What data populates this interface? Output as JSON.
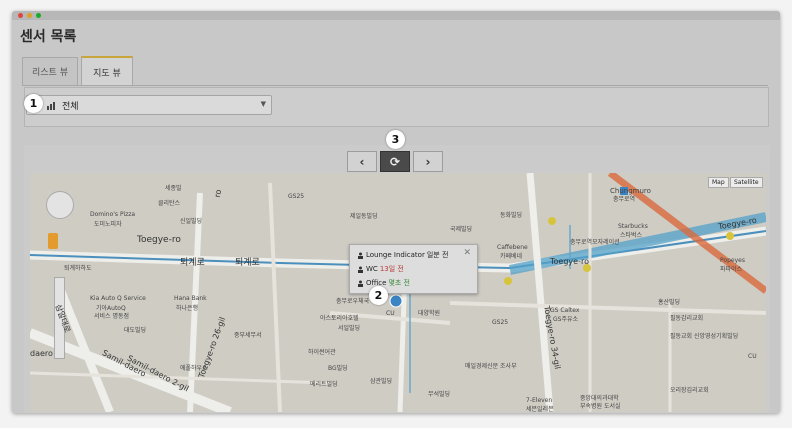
{
  "window": {
    "dots": [
      "#e0443e",
      "#dea123",
      "#1aab29"
    ]
  },
  "page": {
    "title": "센서 목록"
  },
  "tabs": [
    {
      "label": "리스트 뷰",
      "active": false
    },
    {
      "label": "지도 뷰",
      "active": true
    }
  ],
  "filter": {
    "selected": "전체"
  },
  "map_nav": {
    "prev": "‹",
    "refresh": "⟳",
    "next": "›"
  },
  "map": {
    "type_buttons": [
      "Map",
      "Satellite"
    ],
    "popup": {
      "rows": [
        {
          "device": "Lounge Indicator",
          "time": "일분 전",
          "time_color": "normal"
        },
        {
          "device": "WC",
          "time": "13일 전",
          "time_color": "red"
        },
        {
          "device": "Office",
          "time": "몇초 전",
          "time_color": "green"
        }
      ],
      "close": "✕"
    },
    "labels": {
      "toegye_ro_1": "Toegye-ro",
      "toegye_ro_2": "Toegye-ro",
      "toegye_ro_3": "Toegye-ro",
      "toegye_ro_kr_1": "퇴계로",
      "toegye_ro_kr_2": "퇴계로",
      "chungmuro": "Chungmuro",
      "chungmuro_kr": "충무로역",
      "sejong": "세종빌",
      "gs25_a": "GS25",
      "gs25_b": "GS25",
      "gs25_c": "GS Caltex",
      "gs25_c2": "GS주유소",
      "club": "클리탄스",
      "sinil": "신일빌딩",
      "dominos": "Domino's Pizza",
      "dominos_kr": "도미노피자",
      "jeildong": "제일동빌딩",
      "gukje": "국제빌딩",
      "donghwa": "동화빌딩",
      "caffebene": "Caffebene",
      "caffebene_kr": "카페베네",
      "starbucks": "Starbucks",
      "starbucks_kr": "스타벅스",
      "chungmuro_hotel": "충무로역모자레이션",
      "kia": "Kia Auto Q Service",
      "kia_kr": "기아AutoQ",
      "kia_kr2": "서비스 명동점",
      "hana": "Hana Bank",
      "hana_kr": "하나은행",
      "daedo": "대도빌딩",
      "jungbu": "중부세무서",
      "chungmuro_post": "충무로우체국",
      "astoria": "아스토리아호텔",
      "seoil": "서일빌딩",
      "haisen": "하이썬어관",
      "bg": "BG빌딩",
      "merit": "메리트빌딩",
      "samgwan": "삼관빌딩",
      "euljiro_school": "에폴하우스",
      "daeyang": "대양학원",
      "maeil": "매일경제신문 조사부",
      "museong": "무석빌딩",
      "seven": "7-Eleven",
      "seven_kr": "세븐일레븐",
      "joongang_hosp": "중앙대의과대학",
      "joongang_hosp2": "부속병원 도서실",
      "oribang": "오리장김리교회",
      "hongsan": "홍산빌딩",
      "pilgeon": "필동감리교회",
      "pilgeon2": "필동교회 신앙영성기획빌딩",
      "popeyes": "Popeyes",
      "popeyes_kr": "파파이스",
      "cu_a": "CU",
      "cu_b": "CU",
      "samil_1": "Samil-daero",
      "samil_2": "Samil-daero 2-gil",
      "samil_kr": "삼일대로",
      "toegye_26": "Toegye-ro 26-gil",
      "toegye_34": "Toegye-ro 34-gil",
      "chungmuro_kr2": "충무로",
      "toegye_road_v": "ro",
      "daero": "daero",
      "toihaho": "퇴계하하도"
    }
  },
  "annotations": [
    "1",
    "2",
    "3"
  ]
}
